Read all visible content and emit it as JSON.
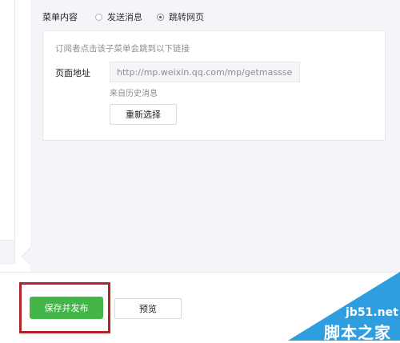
{
  "menu_content": {
    "label": "菜单内容",
    "options": [
      {
        "label": "发送消息",
        "checked": false
      },
      {
        "label": "跳转网页",
        "checked": true
      }
    ]
  },
  "link_card": {
    "hint": "订阅者点击该子菜单会跳到以下链接",
    "address_label": "页面地址",
    "address_value": "http://mp.weixin.qq.com/mp/getmasssen",
    "source_text": "来自历史消息",
    "reselect_label": "重新选择"
  },
  "footer": {
    "save_publish_label": "保存并发布",
    "preview_label": "预览"
  },
  "watermark": {
    "site": "jb51.net",
    "name": "脚本之家"
  },
  "colors": {
    "primary_green": "#44b549",
    "highlight_red": "#b0252a",
    "panel_bg": "#f4f5f9",
    "watermark_blue": "#2f9ee0"
  }
}
